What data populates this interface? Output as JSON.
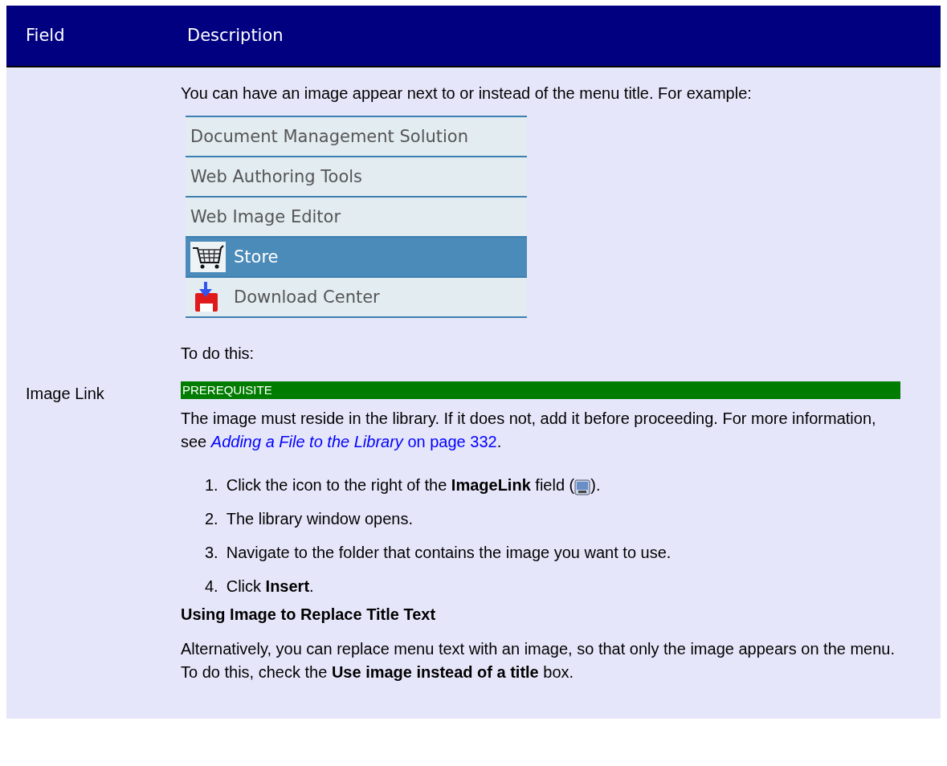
{
  "table": {
    "columns": [
      "Field",
      "Description"
    ],
    "rows": [
      {
        "field": "Image Link",
        "blocks": [
          {
            "kind": "paragraph",
            "text": "You can have an image appear next to or instead of the menu title. For example:"
          },
          {
            "kind": "menu-example",
            "items": [
              {
                "kind": "plain",
                "label": "Document Management Solution",
                "selected": false
              },
              {
                "kind": "plain",
                "label": "Web Authoring Tools",
                "selected": false
              },
              {
                "kind": "plain",
                "label": "Web Image Editor",
                "selected": false
              },
              {
                "kind": "cart",
                "label": "Store",
                "selected": true
              },
              {
                "kind": "download",
                "label": "Download Center",
                "selected": false
              }
            ]
          },
          {
            "kind": "paragraph",
            "text": "To do this:"
          },
          {
            "kind": "prerequisite",
            "label": "PREREQUISITE",
            "text": "The image must reside in the library. If it does not, add it before proceeding. For more information, see ",
            "link": "*Adding a File to the Library* on page 332",
            "after": "."
          },
          {
            "kind": "steps",
            "items": [
              {
                "kind": "with-icon",
                "number": "1.",
                "text": "Click the icon to the right of the **ImageLink** field (",
                "after": ")."
              },
              {
                "kind": "plain",
                "number": "2.",
                "text": "The library window opens."
              },
              {
                "kind": "plain",
                "number": "3.",
                "text": "Navigate to the folder that contains the image you want to use."
              },
              {
                "kind": "plain",
                "number": "4.",
                "text": "Click **Insert**."
              }
            ]
          },
          {
            "kind": "heading",
            "text": "Using Image to Replace Title Text"
          },
          {
            "kind": "paragraph",
            "text": "Alternatively, you can replace menu text with an image, so that only the image appears on the menu. To do this, check the **Use image instead of a title** box."
          }
        ]
      }
    ]
  }
}
